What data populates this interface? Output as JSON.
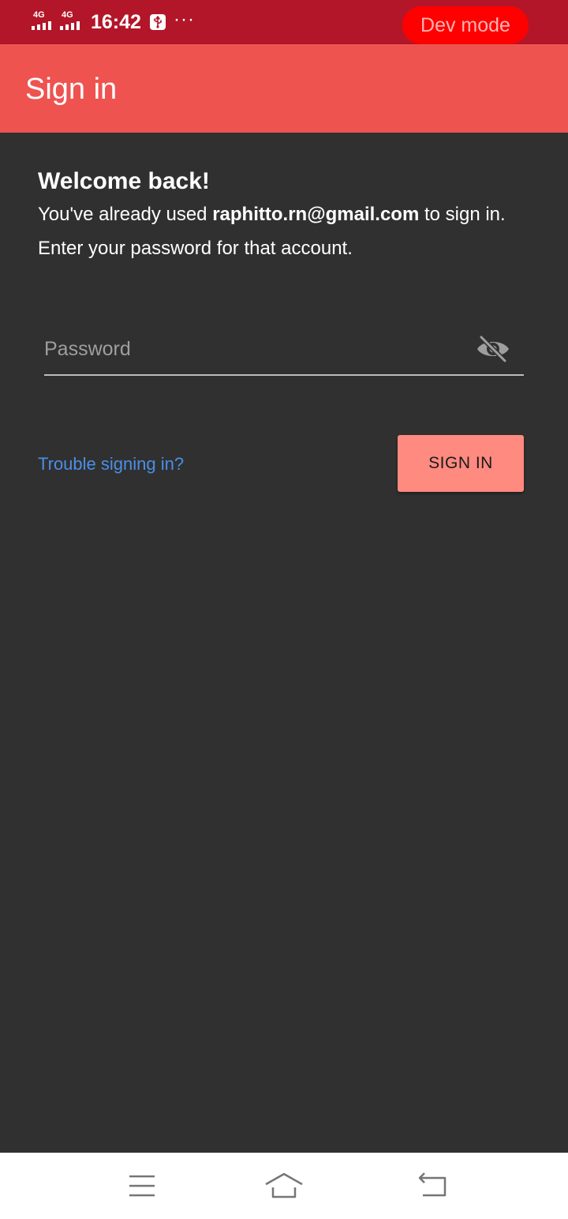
{
  "status_bar": {
    "network_1": "4G",
    "network_2": "4G",
    "time": "16:42",
    "more": "···",
    "dev_mode_label": "Dev mode"
  },
  "app_bar": {
    "title": "Sign in"
  },
  "welcome": {
    "heading": "Welcome back!",
    "body_prefix": "You've already used ",
    "email": "raphitto.rn@gmail.com",
    "body_suffix": " to sign in. Enter your password for that account."
  },
  "password": {
    "placeholder": "Password",
    "value": ""
  },
  "actions": {
    "trouble_label": "Trouble signing in?",
    "signin_label": "SIGN IN"
  },
  "colors": {
    "status_bar": "#B31629",
    "app_bar": "#EF5350",
    "background": "#303030",
    "link": "#4A8FE8",
    "button": "#FF8A80",
    "dev_pill": "#FF0000"
  },
  "icons": {
    "password_toggle": "eye-off-icon",
    "nav_menu": "menu-icon",
    "nav_home": "home-icon",
    "nav_back": "back-icon"
  }
}
